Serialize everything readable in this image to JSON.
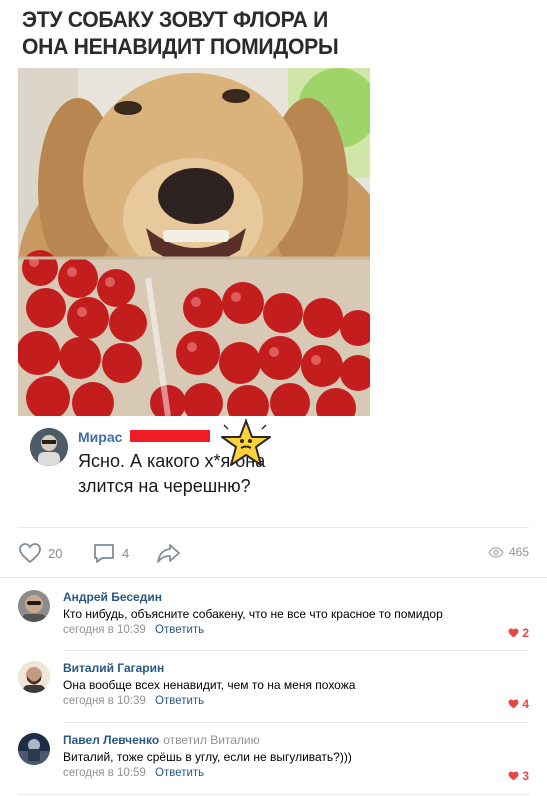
{
  "meme": {
    "title_line1": "ЭТУ СОБАКУ ЗОВУТ ФЛОРА И",
    "title_line2": "ОНА НЕНАВИДИТ ПОМИДОРЫ"
  },
  "embedded_comment": {
    "author": "Мирас",
    "text_line1": "Ясно. А какого х*я она",
    "text_line2": "злится на черешню?"
  },
  "post_actions": {
    "likes": "20",
    "comments": "4",
    "views": "465"
  },
  "colors": {
    "link": "#2a5885",
    "meta": "#939393",
    "like_red": "#e64646",
    "redaction": "#ee1c24"
  },
  "comments": [
    {
      "author": "Андрей Беседин",
      "replied_to": "",
      "text": "Кто нибудь, объясните собакену, что не все что красное то помидор",
      "time": "сегодня в 10:39",
      "reply_label": "Ответить",
      "likes": "2"
    },
    {
      "author": "Виталий Гагарин",
      "replied_to": "",
      "text": "Она вообще всех ненавидит, чем то на меня похожа",
      "time": "сегодня в 10:39",
      "reply_label": "Ответить",
      "likes": "4"
    },
    {
      "author": "Павел Левченко",
      "replied_to": "ответил Виталию",
      "text": "Виталий, тоже срёшь в углу, если не выгуливать?)))",
      "time": "сегодня в 10:59",
      "reply_label": "Ответить",
      "likes": "3"
    }
  ]
}
